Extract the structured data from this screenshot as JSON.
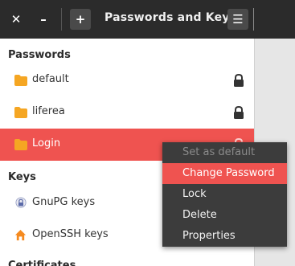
{
  "window": {
    "title": "Passwords and Keys"
  },
  "titlebar": {
    "close": "✕",
    "minimize": "–",
    "add": "+",
    "menu": "☰"
  },
  "sections": {
    "passwords": "Passwords",
    "keys": "Keys",
    "certificates": "Certificates"
  },
  "passwords": [
    {
      "label": "default",
      "locked": true
    },
    {
      "label": "liferea",
      "locked": true
    },
    {
      "label": "Login",
      "locked": false,
      "selected": true
    }
  ],
  "keys": [
    {
      "label": "GnuPG keys"
    },
    {
      "label": "OpenSSH keys"
    }
  ],
  "context_menu": [
    {
      "label": "Set as default",
      "enabled": false
    },
    {
      "label": "Change Password",
      "enabled": true,
      "highlighted": true
    },
    {
      "label": "Lock",
      "enabled": true
    },
    {
      "label": "Delete",
      "enabled": true
    },
    {
      "label": "Properties",
      "enabled": true
    }
  ],
  "colors": {
    "accent": "#ef5350",
    "titlebar": "#2b2b2b",
    "folder": "#f5a623",
    "menu_bg": "#3c3c3c"
  }
}
